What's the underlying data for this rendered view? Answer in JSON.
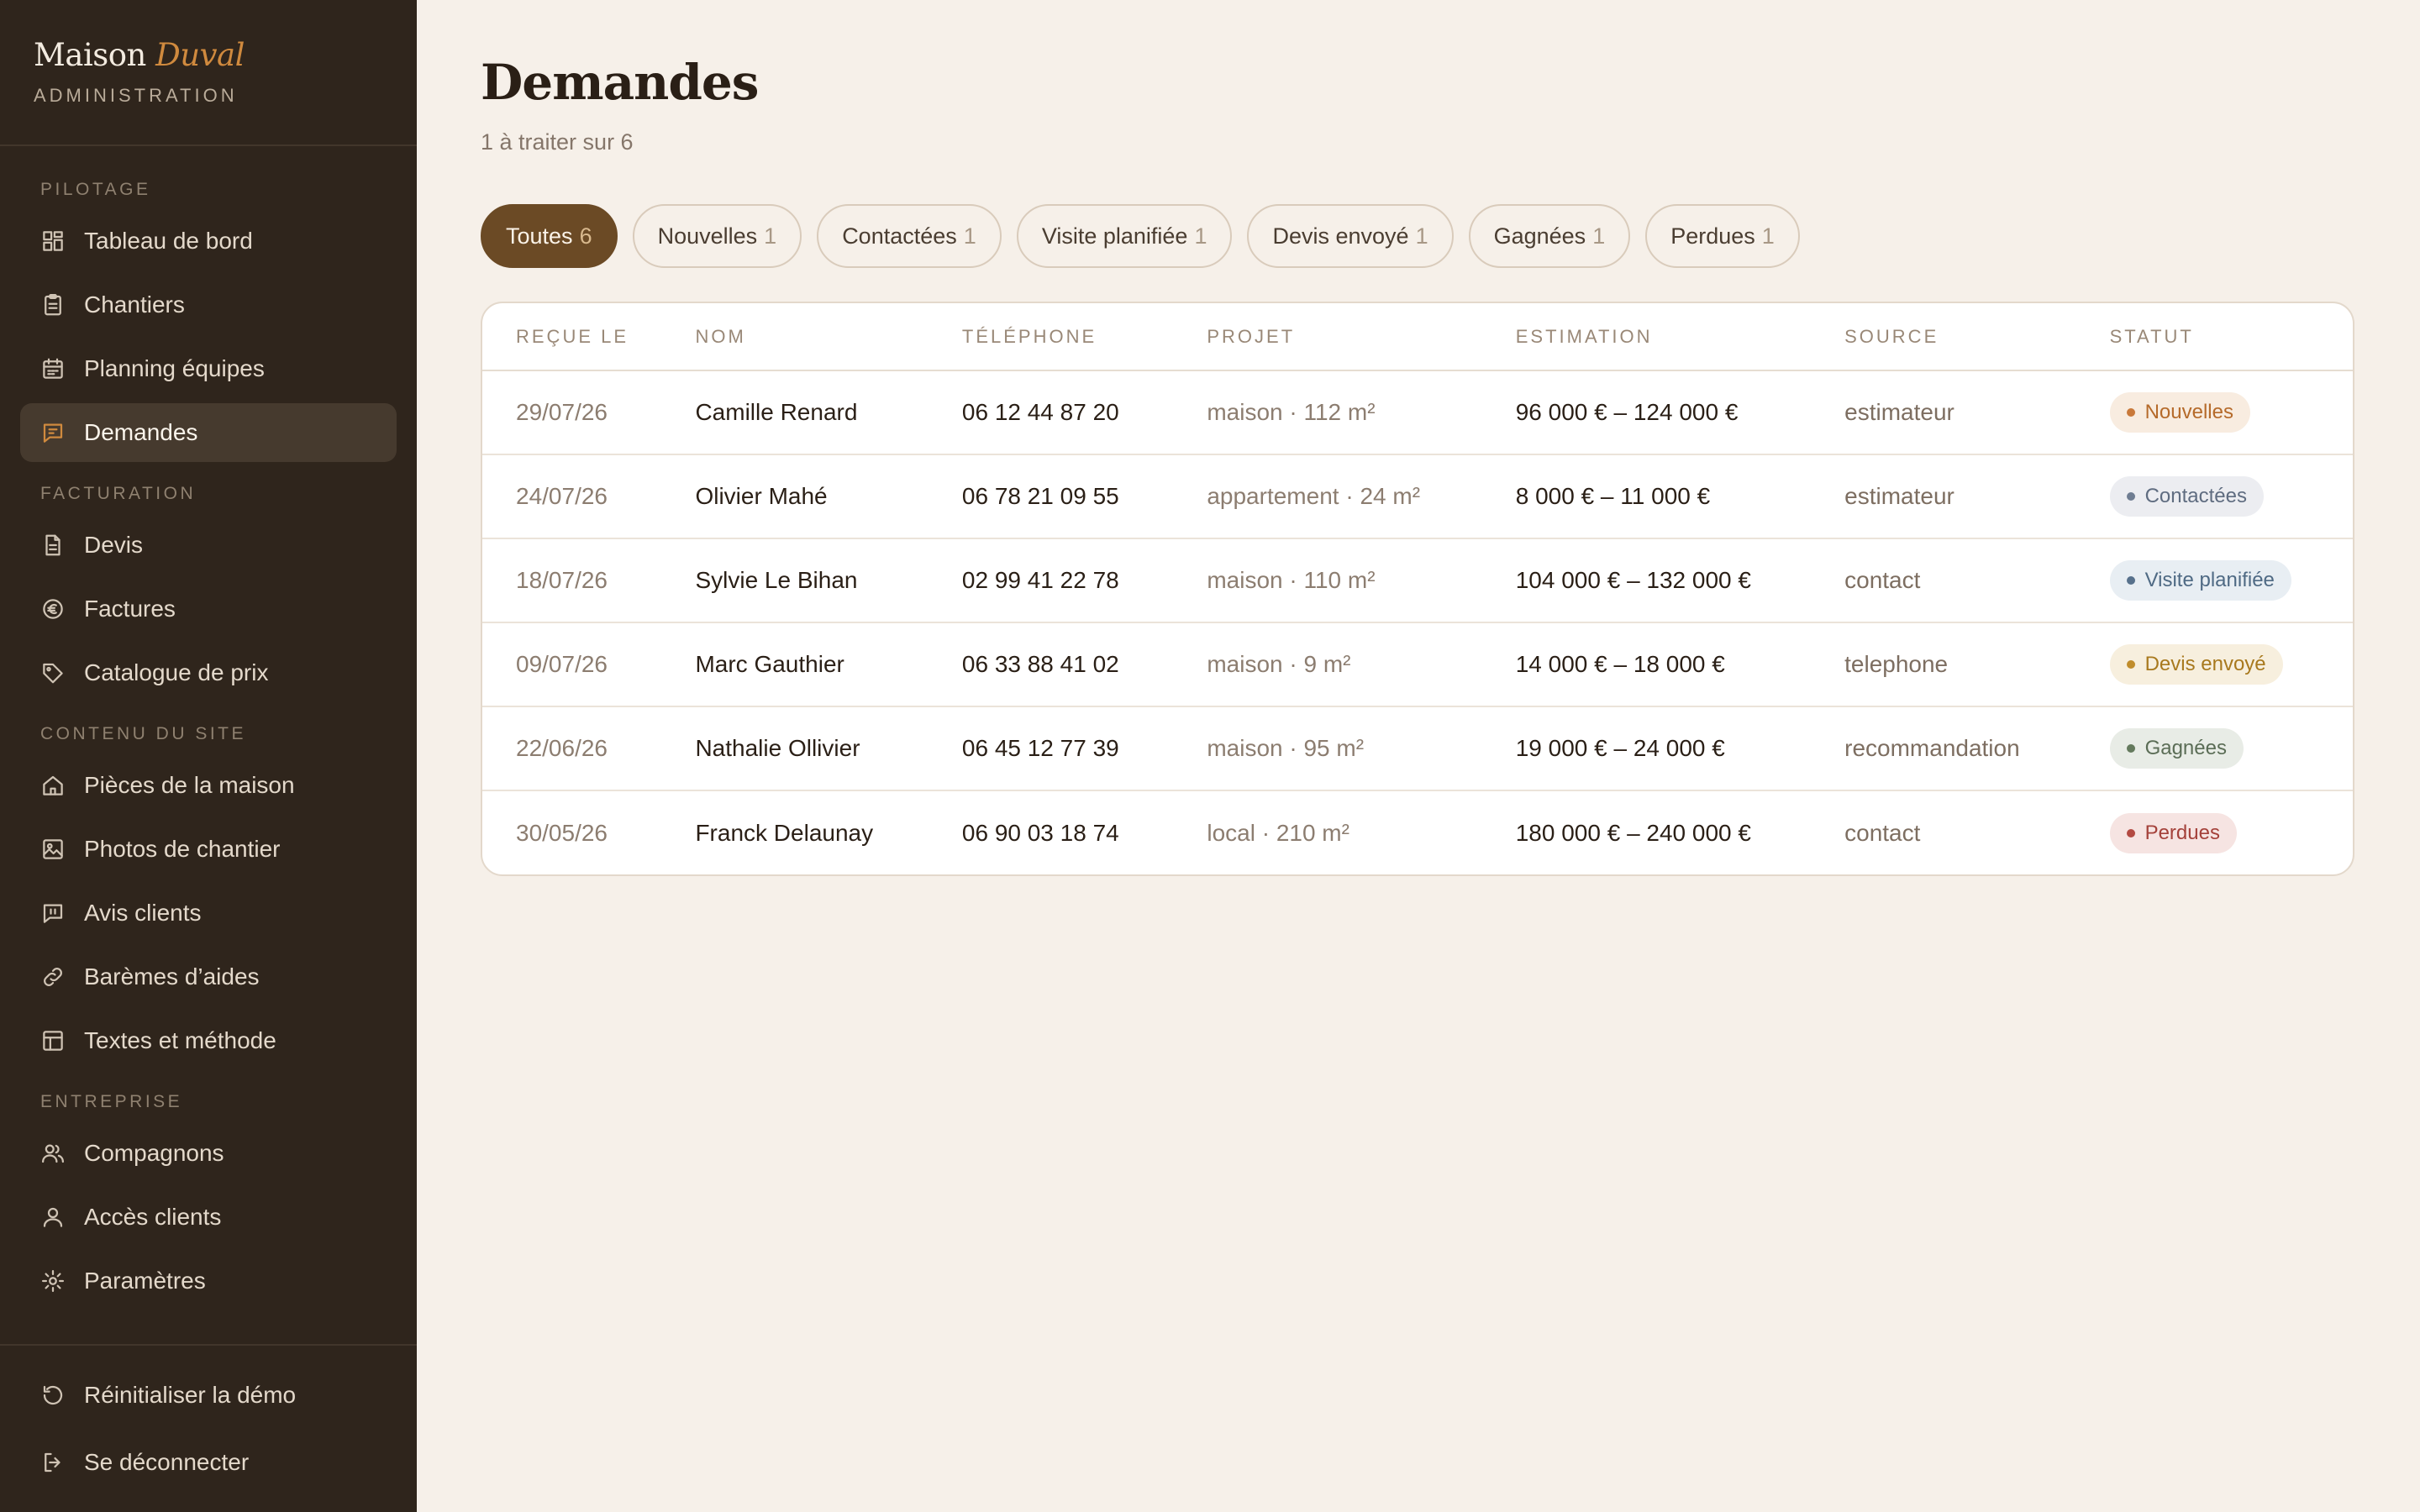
{
  "brand": {
    "name_main": "Maison",
    "name_accent": "Duval",
    "subtitle": "ADMINISTRATION"
  },
  "sidebar": {
    "sections": [
      {
        "title": "PILOTAGE",
        "items": [
          {
            "label": "Tableau de bord",
            "icon": "dashboard-icon",
            "active": false
          },
          {
            "label": "Chantiers",
            "icon": "clipboard-icon",
            "active": false
          },
          {
            "label": "Planning équipes",
            "icon": "calendar-icon",
            "active": false
          },
          {
            "label": "Demandes",
            "icon": "message-icon",
            "active": true
          }
        ]
      },
      {
        "title": "FACTURATION",
        "items": [
          {
            "label": "Devis",
            "icon": "document-icon",
            "active": false
          },
          {
            "label": "Factures",
            "icon": "euro-icon",
            "active": false
          },
          {
            "label": "Catalogue de prix",
            "icon": "tag-icon",
            "active": false
          }
        ]
      },
      {
        "title": "CONTENU DU SITE",
        "items": [
          {
            "label": "Pièces de la maison",
            "icon": "home-icon",
            "active": false
          },
          {
            "label": "Photos de chantier",
            "icon": "image-icon",
            "active": false
          },
          {
            "label": "Avis clients",
            "icon": "review-icon",
            "active": false
          },
          {
            "label": "Barèmes d’aides",
            "icon": "link-icon",
            "active": false
          },
          {
            "label": "Textes et méthode",
            "icon": "layout-icon",
            "active": false
          }
        ]
      },
      {
        "title": "ENTREPRISE",
        "items": [
          {
            "label": "Compagnons",
            "icon": "users-icon",
            "active": false
          },
          {
            "label": "Accès clients",
            "icon": "user-icon",
            "active": false
          },
          {
            "label": "Paramètres",
            "icon": "gear-icon",
            "active": false
          }
        ]
      }
    ],
    "footer": [
      {
        "label": "Réinitialiser la démo",
        "icon": "reset-icon"
      },
      {
        "label": "Se déconnecter",
        "icon": "logout-icon"
      }
    ]
  },
  "page": {
    "title": "Demandes",
    "subtitle": "1 à traiter sur 6"
  },
  "filters": [
    {
      "label": "Toutes",
      "count": "6",
      "active": true
    },
    {
      "label": "Nouvelles",
      "count": "1",
      "active": false
    },
    {
      "label": "Contactées",
      "count": "1",
      "active": false
    },
    {
      "label": "Visite planifiée",
      "count": "1",
      "active": false
    },
    {
      "label": "Devis envoyé",
      "count": "1",
      "active": false
    },
    {
      "label": "Gagnées",
      "count": "1",
      "active": false
    },
    {
      "label": "Perdues",
      "count": "1",
      "active": false
    }
  ],
  "table": {
    "columns": [
      "REÇUE LE",
      "NOM",
      "TÉLÉPHONE",
      "PROJET",
      "ESTIMATION",
      "SOURCE",
      "STATUT"
    ],
    "rows": [
      {
        "date": "29/07/26",
        "name": "Camille Renard",
        "phone": "06 12 44 87 20",
        "project": "maison · 112 m²",
        "estimate": "96 000 € – 124 000 €",
        "source": "estimateur",
        "status": "Nouvelles",
        "status_key": "nouvelles"
      },
      {
        "date": "24/07/26",
        "name": "Olivier Mahé",
        "phone": "06 78 21 09 55",
        "project": "appartement · 24 m²",
        "estimate": "8 000 € – 11 000 €",
        "source": "estimateur",
        "status": "Contactées",
        "status_key": "contactees"
      },
      {
        "date": "18/07/26",
        "name": "Sylvie Le Bihan",
        "phone": "02 99 41 22 78",
        "project": "maison · 110 m²",
        "estimate": "104 000 € – 132 000 €",
        "source": "contact",
        "status": "Visite planifiée",
        "status_key": "visite"
      },
      {
        "date": "09/07/26",
        "name": "Marc Gauthier",
        "phone": "06 33 88 41 02",
        "project": "maison · 9 m²",
        "estimate": "14 000 € – 18 000 €",
        "source": "telephone",
        "status": "Devis envoyé",
        "status_key": "devis"
      },
      {
        "date": "22/06/26",
        "name": "Nathalie Ollivier",
        "phone": "06 45 12 77 39",
        "project": "maison · 95 m²",
        "estimate": "19 000 € – 24 000 €",
        "source": "recommandation",
        "status": "Gagnées",
        "status_key": "gagnees"
      },
      {
        "date": "30/05/26",
        "name": "Franck Delaunay",
        "phone": "06 90 03 18 74",
        "project": "local · 210 m²",
        "estimate": "180 000 € – 240 000 €",
        "source": "contact",
        "status": "Perdues",
        "status_key": "perdues"
      }
    ]
  },
  "status_colors": {
    "nouvelles": {
      "bg": "#f8ece0",
      "fg": "#b56a2a",
      "dot": "#c9793a"
    },
    "contactees": {
      "bg": "#ecedf1",
      "fg": "#5f6c80",
      "dot": "#6f7d92"
    },
    "visite": {
      "bg": "#e8eef3",
      "fg": "#4f6a84",
      "dot": "#57718c"
    },
    "devis": {
      "bg": "#f7efde",
      "fg": "#a8791e",
      "dot": "#c08d2c"
    },
    "gagnees": {
      "bg": "#e8ece6",
      "fg": "#5b6d56",
      "dot": "#647a5d"
    },
    "perdues": {
      "bg": "#f6e4e2",
      "fg": "#a4413a",
      "dot": "#b34a42"
    }
  }
}
